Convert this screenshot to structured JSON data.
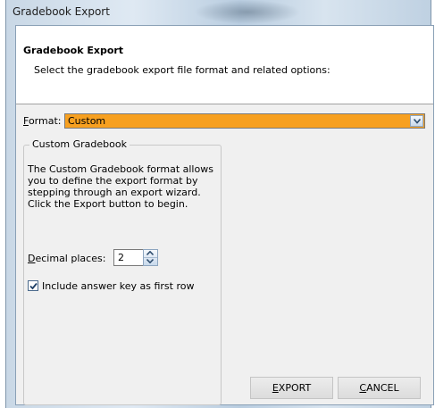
{
  "window": {
    "title": "Gradebook Export"
  },
  "header": {
    "title": "Gradebook Export",
    "description": "Select the gradebook export file format and related options:"
  },
  "format": {
    "label_access": "F",
    "label_rest": "ormat:",
    "selected": "Custom",
    "highlight_color": "#f7a020"
  },
  "custom_group": {
    "legend": "Custom Gradebook",
    "description": "The Custom Gradebook format allows you to define the export format by stepping through an export wizard. Click the Export button to begin."
  },
  "decimal": {
    "label_access": "D",
    "label_rest": "ecimal places:",
    "value": "2"
  },
  "answer_key": {
    "label": "Include answer key as first row",
    "checked": true
  },
  "buttons": {
    "export_access": "E",
    "export_rest": "XPORT",
    "cancel_access": "C",
    "cancel_rest": "ANCEL"
  },
  "icons": {
    "dropdown": "chevron-down-icon",
    "spin_up": "arrow-up-icon",
    "spin_down": "arrow-down-icon",
    "check": "check-icon"
  }
}
